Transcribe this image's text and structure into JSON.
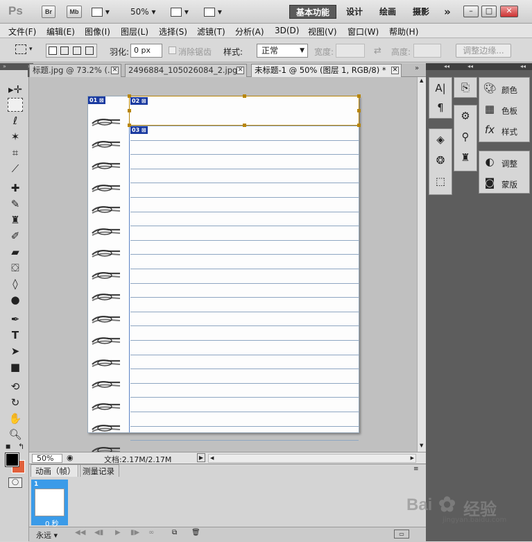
{
  "app": {
    "logo": "Ps",
    "bridge_btn": "Br",
    "minibridge_btn": "Mb",
    "zoom_level": "50%",
    "workspaces": [
      "基本功能",
      "设计",
      "绘画",
      "摄影"
    ],
    "more": "»",
    "window_buttons": [
      "–",
      "□",
      "✕"
    ]
  },
  "menu": {
    "items": [
      "文件(F)",
      "编辑(E)",
      "图像(I)",
      "图层(L)",
      "选择(S)",
      "滤镜(T)",
      "分析(A)",
      "3D(D)",
      "视图(V)",
      "窗口(W)",
      "帮助(H)"
    ]
  },
  "options": {
    "feather_label": "羽化:",
    "feather_value": "0 px",
    "antialias_label": "消除锯齿",
    "style_label": "样式:",
    "style_value": "正常",
    "width_label": "宽度:",
    "height_label": "高度:",
    "refine_edge": "调整边缘..."
  },
  "tabs": [
    {
      "title": "标题.jpg @ 73.2% (...",
      "active": false
    },
    {
      "title": "2496884_105026084_2.jpg",
      "active": false
    },
    {
      "title": "未标题-1 @ 50% (图层 1, RGB/8) *",
      "active": true
    }
  ],
  "canvas": {
    "slice_labels": [
      "01",
      "02",
      "03"
    ],
    "line_count": 23
  },
  "status": {
    "zoom": "50%",
    "doc_info": "文档:2.17M/2.17M"
  },
  "animation": {
    "tabs": [
      "动画（帧）",
      "测量记录"
    ],
    "frame_number": "1",
    "frame_delay": "0 秒",
    "loop": "永远"
  },
  "right_panels": {
    "col3_labels": [
      "颜色",
      "色板",
      "样式",
      "调整",
      "蒙版"
    ]
  },
  "watermark": {
    "brand": "Bai",
    "brand2": "经验",
    "url": "jingyan.baidu.com"
  },
  "colors": {
    "foreground": "#000000",
    "background": "#e0603c",
    "frame_highlight": "#3b9be8",
    "slice_tag": "#1a3aa0",
    "selection": "#b8860b"
  }
}
